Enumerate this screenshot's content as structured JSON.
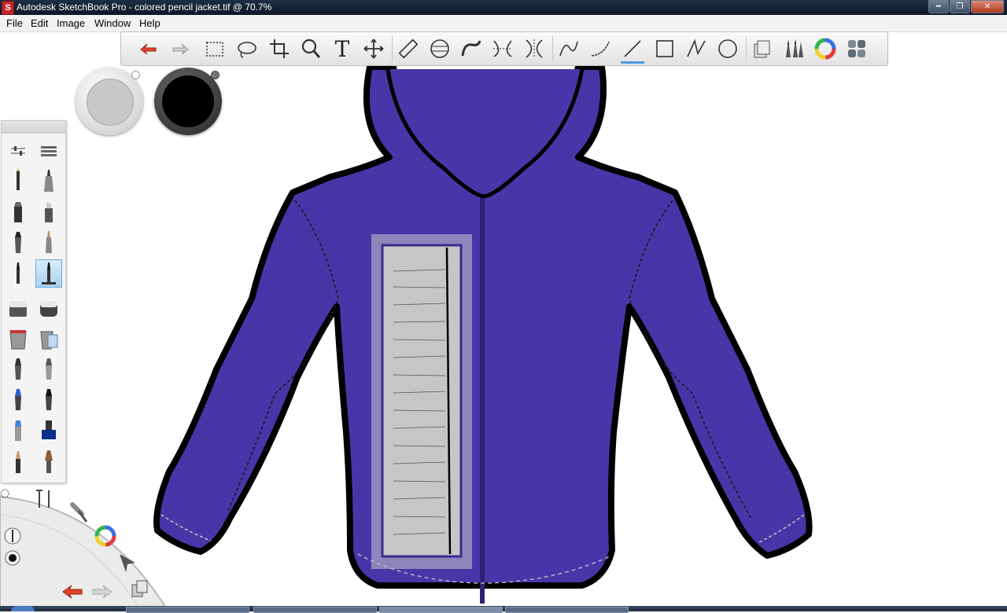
{
  "window": {
    "title": "Autodesk SketchBook Pro - colored pencil jacket.tif @ 70.7%"
  },
  "menu": {
    "items": [
      "File",
      "Edit",
      "Image",
      "Window",
      "Help"
    ]
  },
  "toolbar": {
    "tools": [
      "undo-icon",
      "redo-icon",
      "rect-select-icon",
      "lasso-icon",
      "crop-icon",
      "zoom-icon",
      "text-icon",
      "move-icon",
      "ruler-icon",
      "ellipse-guide-icon",
      "french-curve-icon",
      "symmetry-x-icon",
      "symmetry-y-icon",
      "line-icon",
      "curve-icon",
      "straight-line-icon",
      "rectangle-icon",
      "polyline-icon",
      "circle-icon",
      "layers-icon",
      "brushes-icon",
      "color-wheel-icon",
      "copic-palette-icon"
    ],
    "active_tool": "straight-line-icon",
    "text_tool_glyph": "T"
  },
  "colors": {
    "primary": "#c8c8c8",
    "secondary": "#000000",
    "jacket": "#4a35a8",
    "jacket_dark": "#3b2a8f",
    "tag": "#c6c6c9",
    "accent": "#4a9de0"
  },
  "brush_palette": {
    "selected_index": 7
  }
}
